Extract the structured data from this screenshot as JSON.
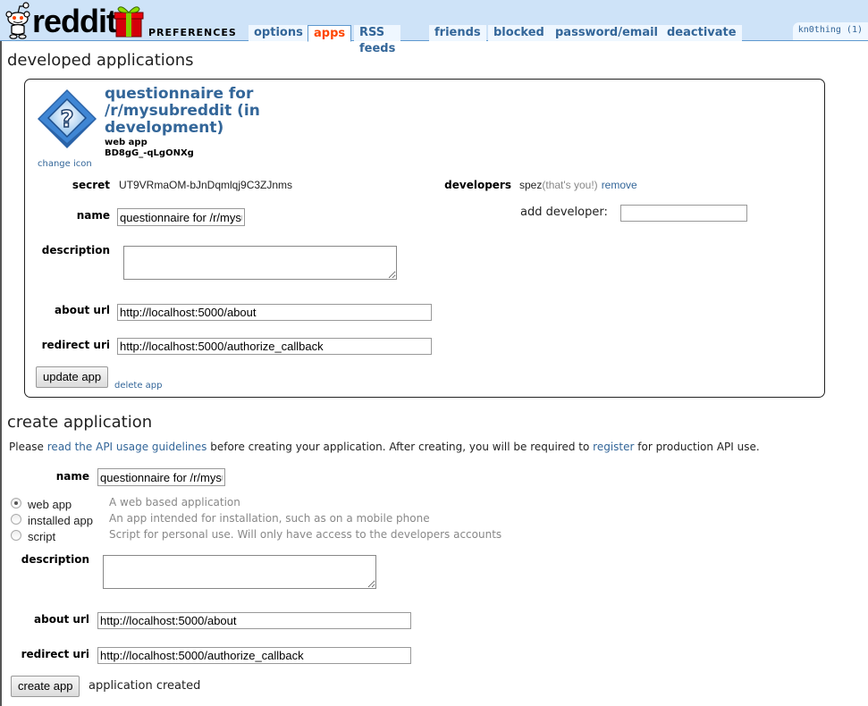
{
  "header": {
    "brand": "reddit",
    "page_name": "PREFERENCES",
    "tabs": [
      {
        "label": "options",
        "selected": false
      },
      {
        "label": "apps",
        "selected": true
      },
      {
        "label": "RSS feeds",
        "selected": false
      },
      {
        "label": "friends",
        "selected": false
      },
      {
        "label": "blocked",
        "selected": false
      },
      {
        "label": "password/email",
        "selected": false
      },
      {
        "label": "deactivate",
        "selected": false
      }
    ],
    "user": "kn0thing (1)",
    "colors": {
      "header_bg": "#cee3f8",
      "tab_bg": "#eff7ff",
      "selected_tab": "#ff4500",
      "link": "#369"
    }
  },
  "developed": {
    "heading": "developed applications",
    "app": {
      "icon": "question-mark-diamond-icon",
      "change_icon_label": "change icon",
      "title": "questionnaire for /r/mysubreddit (in development)",
      "type": "web app",
      "client_id": "BD8gG_-qLgONXg",
      "secret_label": "secret",
      "secret": "UT9VRmaOM-bJnDqmlqj9C3ZJnms",
      "developers_label": "developers",
      "developer_name": "spez",
      "developer_note": "(that's you!)",
      "remove_label": "remove",
      "add_developer_label": "add developer:",
      "add_developer_value": "",
      "name_label": "name",
      "name_value": "questionnaire for /r/mysubreddit",
      "description_label": "description",
      "description_value": "",
      "about_url_label": "about url",
      "about_url_value": "http://localhost:5000/about",
      "redirect_uri_label": "redirect uri",
      "redirect_uri_value": "http://localhost:5000/authorize_callback",
      "update_button": "update app",
      "delete_link": "delete app"
    }
  },
  "create": {
    "heading": "create application",
    "info_prefix": "Please ",
    "info_link1": "read the API usage guidelines",
    "info_middle": " before creating your application. After creating, you will be required to ",
    "info_link2": "register",
    "info_suffix": " for production API use.",
    "name_label": "name",
    "name_value": "questionnaire for /r/mysubreddit",
    "app_types": [
      {
        "label": "web app",
        "description": "A web based application",
        "checked": true
      },
      {
        "label": "installed app",
        "description": "An app intended for installation, such as on a mobile phone",
        "checked": false
      },
      {
        "label": "script",
        "description": "Script for personal use. Will only have access to the developers accounts",
        "checked": false
      }
    ],
    "description_label": "description",
    "description_value": "",
    "about_url_label": "about url",
    "about_url_value": "http://localhost:5000/about",
    "redirect_uri_label": "redirect uri",
    "redirect_uri_value": "http://localhost:5000/authorize_callback",
    "create_button": "create app",
    "status": "application created"
  }
}
